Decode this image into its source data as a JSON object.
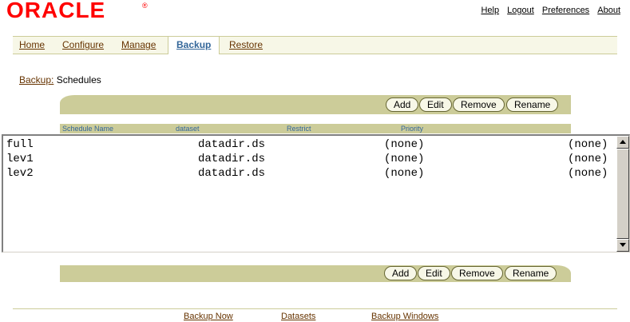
{
  "brand": {
    "logo_text": "ORACLE",
    "registered_mark": "®",
    "color": "#ff0000"
  },
  "global_links": [
    "Help",
    "Logout",
    "Preferences",
    "About"
  ],
  "tabs": [
    {
      "label": "Home",
      "active": false
    },
    {
      "label": "Configure",
      "active": false
    },
    {
      "label": "Manage",
      "active": false
    },
    {
      "label": "Backup",
      "active": true
    },
    {
      "label": "Restore",
      "active": false
    }
  ],
  "breadcrumb": {
    "link": "Backup:",
    "current": "Schedules"
  },
  "actions": {
    "add": "Add",
    "edit": "Edit",
    "remove": "Remove",
    "rename": "Rename"
  },
  "columns": {
    "name": "Schedule Name",
    "dataset": "dataset",
    "restrict": "Restrict",
    "priority": "Priority"
  },
  "schedules": [
    {
      "name": "full",
      "dataset": "datadir.ds",
      "restrict": "(none)",
      "priority": "(none)"
    },
    {
      "name": "lev1",
      "dataset": "datadir.ds",
      "restrict": "(none)",
      "priority": "(none)"
    },
    {
      "name": "lev2",
      "dataset": "datadir.ds",
      "restrict": "(none)",
      "priority": "(none)"
    }
  ],
  "footer_links": [
    "Backup Now",
    "Datasets",
    "Backup Windows"
  ],
  "colors": {
    "accent_bar": "#cccc99",
    "tab_bg": "#f7f7e7",
    "link": "#663300",
    "active_tab": "#336699"
  }
}
